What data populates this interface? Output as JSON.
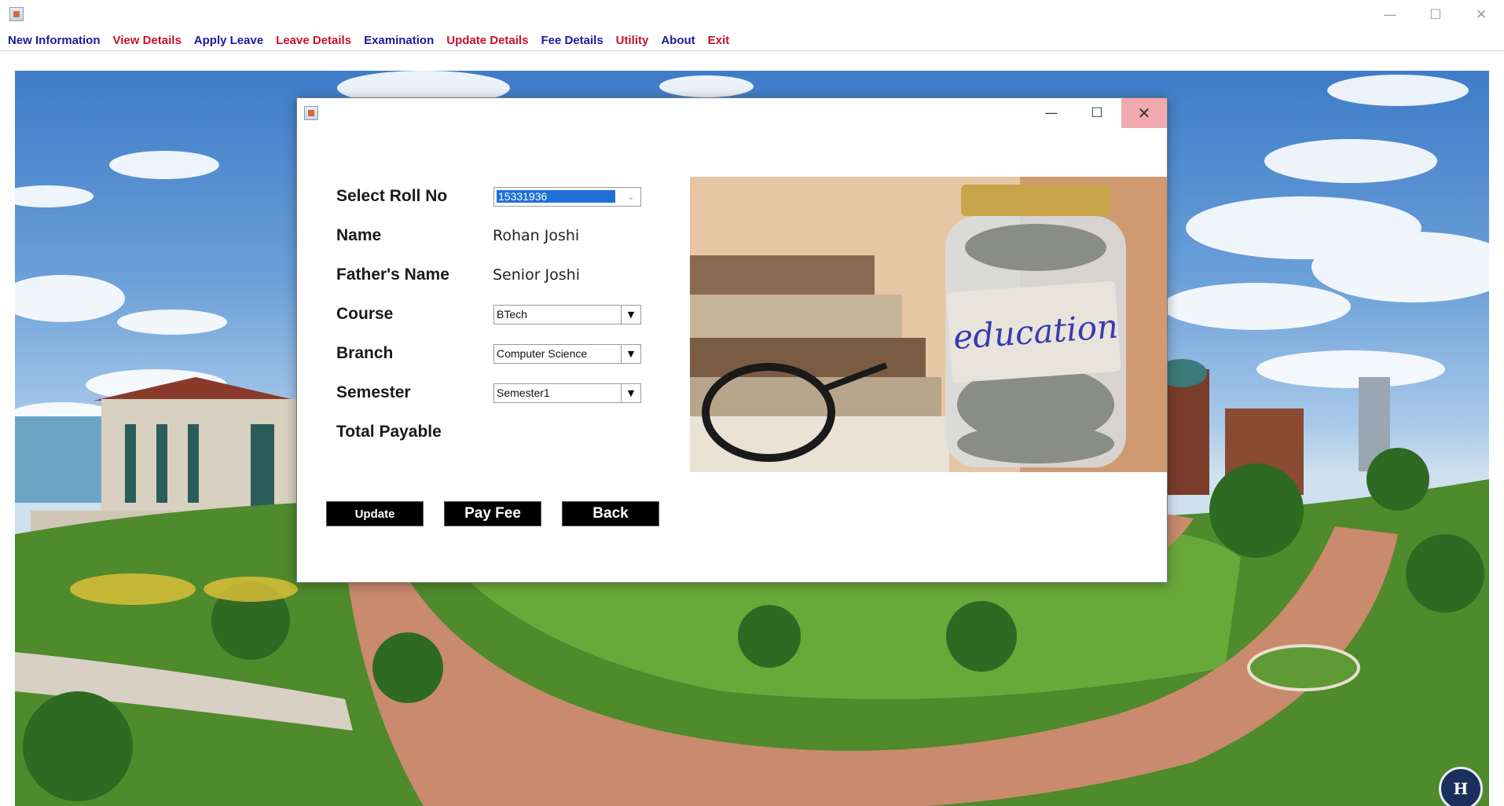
{
  "window": {
    "controls": {
      "minimize": "—",
      "maximize": "☐",
      "close": "✕"
    }
  },
  "menu": [
    {
      "label": "New Information",
      "color": "#1a1a9e"
    },
    {
      "label": "View Details",
      "color": "#c8102e"
    },
    {
      "label": "Apply Leave",
      "color": "#1a1a9e"
    },
    {
      "label": "Leave Details",
      "color": "#c8102e"
    },
    {
      "label": "Examination",
      "color": "#1a1a9e"
    },
    {
      "label": "Update Details",
      "color": "#c8102e"
    },
    {
      "label": "Fee Details",
      "color": "#1a1a9e"
    },
    {
      "label": "Utility",
      "color": "#c8102e"
    },
    {
      "label": "About",
      "color": "#1a1a9e"
    },
    {
      "label": "Exit",
      "color": "#c8102e"
    }
  ],
  "dialog": {
    "controls": {
      "minimize": "—",
      "maximize": "☐",
      "close": "✕"
    },
    "fields": {
      "roll_no": {
        "label": "Select Roll No",
        "value": "15331936"
      },
      "name": {
        "label": "Name",
        "value": "Rohan Joshi"
      },
      "father_name": {
        "label": "Father's Name",
        "value": "Senior Joshi"
      },
      "course": {
        "label": "Course",
        "value": "BTech"
      },
      "branch": {
        "label": "Branch",
        "value": "Computer Science"
      },
      "semester": {
        "label": "Semester",
        "value": "Semester1"
      },
      "total_payable": {
        "label": "Total Payable",
        "value": ""
      }
    },
    "buttons": {
      "update": "Update",
      "pay_fee": "Pay Fee",
      "back": "Back"
    },
    "image": {
      "jar_label": "education"
    }
  },
  "background": {
    "logo_text": "H"
  },
  "colors": {
    "selection": "#1f6fd6",
    "close_hover": "#f1a9b0",
    "button_bg": "#000000"
  }
}
